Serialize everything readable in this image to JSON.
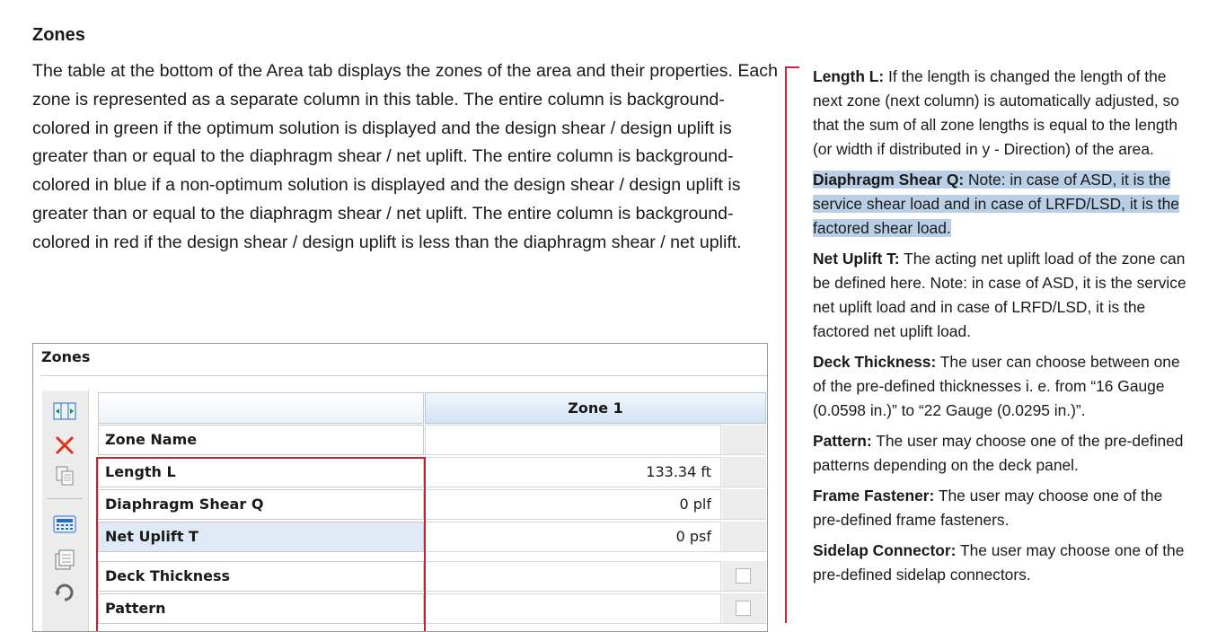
{
  "heading": "Zones",
  "intro": "The table at the bottom of the Area tab displays the zones of the area and their properties. Each zone is represented as a separate column in this table. The entire column is background-colored in green if the optimum solution is displayed and the design shear / design uplift is greater than or equal to the diaphragm shear / net uplift. The entire column is background-colored in blue if a non-optimum solution is displayed and the design shear / design uplift is greater than or equal to the diaphragm shear / net uplift. The entire column is background-colored in red if the design shear / design uplift is less than the diaphragm shear / net uplift.",
  "panel": {
    "title": "Zones",
    "column_header": "Zone 1",
    "rows": [
      {
        "label": "Zone Name",
        "value": ""
      },
      {
        "label": "Length L",
        "value": "133.34 ft"
      },
      {
        "label": "Diaphragm Shear Q",
        "value": "0 plf"
      },
      {
        "label": "Net Uplift T",
        "value": "0 psf"
      },
      {
        "label": "Deck Thickness",
        "value": ""
      },
      {
        "label": "Pattern",
        "value": ""
      }
    ],
    "toolbar_icons": [
      "insert-column-icon",
      "delete-icon",
      "copy-icon",
      "calculator-icon",
      "export-icon",
      "refresh-icon"
    ],
    "colors": {
      "highlight_box": "#c8202f",
      "header_blue": "#d3e2f3"
    }
  },
  "notes": [
    {
      "term": "Length L:",
      "text": " If the length is changed the length of the next zone (next column) is automatically adjusted, so that the sum of all zone lengths is equal to the length (or width if distributed in y - Direction) of the area."
    },
    {
      "term": "Diaphragm Shear Q:",
      "text": " Note: in case of ASD, it is the service shear load and in case of LRFD/LSD, it is the factored shear load."
    },
    {
      "term": "Net Uplift T:",
      "text": " The acting net uplift load of the zone can be defined here. Note: in case of ASD, it is the service net uplift load and in case of LRFD/LSD, it is the factored net uplift load."
    },
    {
      "term": "Deck Thickness:",
      "text": " The user can choose between one of the pre-defined thicknesses i. e. from “16 Gauge (0.0598 in.)” to “22 Gauge (0.0295 in.)”."
    },
    {
      "term": "Pattern:",
      "text": " The user may choose one of the pre-defined patterns depending on the deck panel."
    },
    {
      "term": "Frame Fastener:",
      "text": " The user may choose one of the pre-defined frame fasteners."
    },
    {
      "term": "Sidelap Connector:",
      "text": " The user may choose one of the pre-defined sidelap connectors."
    }
  ],
  "colors": {
    "bracket": "#d0243a",
    "text_highlight": "#b9cfe6"
  }
}
